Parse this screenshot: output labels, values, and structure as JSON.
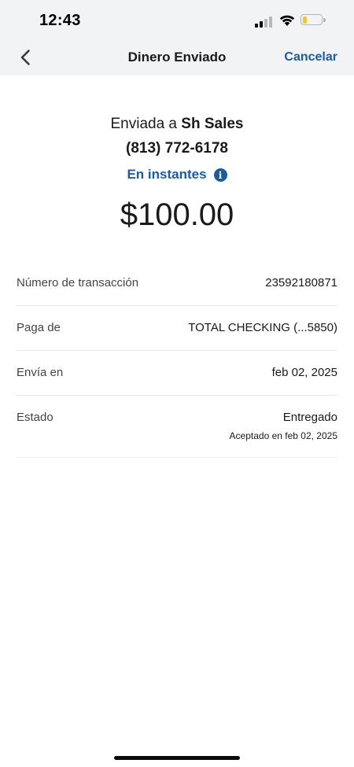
{
  "status_bar": {
    "time": "12:43",
    "signal_bars_active": 2,
    "signal_bars_total": 4,
    "battery_level": 0.22,
    "battery_color": "#f3c81a"
  },
  "nav": {
    "back_icon": "chevron-left-icon",
    "title": "Dinero Enviado",
    "cancel_label": "Cancelar"
  },
  "summary": {
    "sent_to_prefix": "Enviada a ",
    "recipient": "Sh Sales",
    "phone": "(813) 772-6178",
    "speed": "En instantes",
    "info_icon": "info-icon",
    "amount": "$100.00"
  },
  "details": [
    {
      "label": "Número de transacción",
      "value": "23592180871"
    },
    {
      "label": "Paga de",
      "value": "TOTAL CHECKING (...5850)"
    },
    {
      "label": "Envía en",
      "value": "feb 02, 2025"
    },
    {
      "label": "Estado",
      "value": "Entregado",
      "sub": "Aceptado en feb 02, 2025"
    }
  ],
  "colors": {
    "accent": "#1c5b9f",
    "header_bg": "#f2f3f5",
    "text": "#1a1a1a",
    "divider": "#e9eaec"
  }
}
